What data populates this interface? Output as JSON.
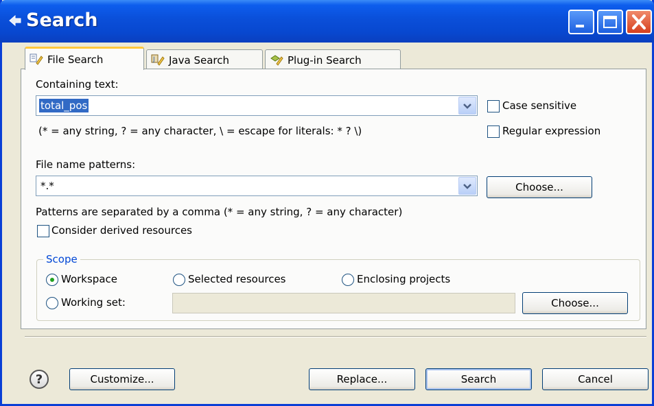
{
  "window": {
    "title": "Search",
    "controls": {
      "minimize": "minimize",
      "maximize": "maximize",
      "close": "close"
    }
  },
  "tabs": [
    {
      "label": "File Search",
      "icon": "file-search-icon",
      "active": true
    },
    {
      "label": "Java Search",
      "icon": "java-search-icon",
      "active": false
    },
    {
      "label": "Plug-in Search",
      "icon": "plugin-search-icon",
      "active": false
    }
  ],
  "containing": {
    "label": "Containing text:",
    "value": "total_pos",
    "hint": "(* = any string, ? = any character, \\ = escape for literals: * ? \\)",
    "case_sensitive_label": "Case sensitive",
    "case_sensitive_checked": false,
    "regex_label": "Regular expression",
    "regex_checked": false
  },
  "file_patterns": {
    "label": "File name patterns:",
    "value": "*.*",
    "choose_label": "Choose...",
    "hint": "Patterns are separated by a comma (* = any string, ? = any character)",
    "derived_label": "Consider derived resources",
    "derived_checked": false
  },
  "scope": {
    "title": "Scope",
    "workspace_label": "Workspace",
    "selected_label": "Selected resources",
    "enclosing_label": "Enclosing projects",
    "working_set_label": "Working set:",
    "working_set_value": "",
    "choose_label": "Choose...",
    "selected_option": "Workspace"
  },
  "footer": {
    "help_symbol": "?",
    "customize_label": "Customize...",
    "replace_label": "Replace...",
    "search_label": "Search",
    "cancel_label": "Cancel"
  },
  "colors": {
    "titlebar": "#0a4fd9",
    "dialog_bg": "#ece9d8",
    "active_tab_accent": "#ffc83c",
    "selection": "#316ac5",
    "group_title": "#0046d5"
  }
}
